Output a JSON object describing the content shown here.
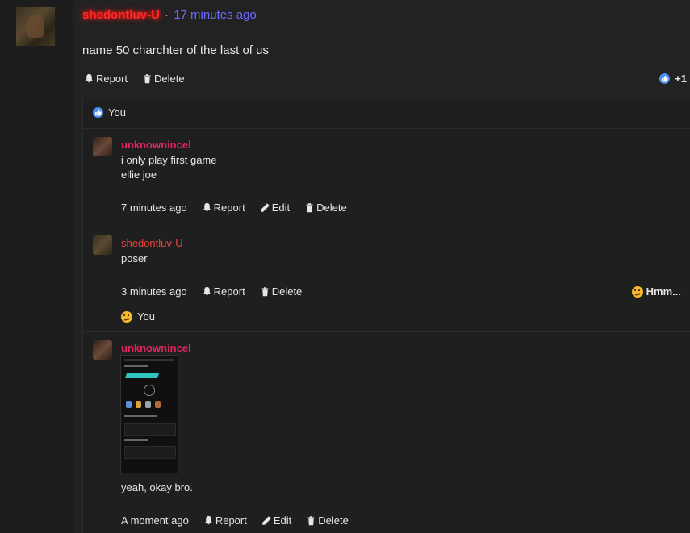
{
  "post": {
    "username": "shedontluv-U",
    "separator": "·",
    "time": "17 minutes ago",
    "text": "name 50 charchter of the last of us",
    "actions": {
      "report": "Report",
      "delete": "Delete"
    },
    "reaction_count": "+1"
  },
  "thread": {
    "reacted_by": "You",
    "replies": [
      {
        "username": "unknownincel",
        "lines": [
          "i only play first game",
          "ellie joe"
        ],
        "time": "7 minutes ago",
        "actions": {
          "report": "Report",
          "edit": "Edit",
          "delete": "Delete"
        }
      },
      {
        "username": "shedontluv-U",
        "lines": [
          "poser"
        ],
        "time": "3 minutes ago",
        "actions": {
          "report": "Report",
          "delete": "Delete"
        },
        "reaction_label": "Hmm...",
        "reacted_by": "You"
      },
      {
        "username": "unknownincel",
        "lines": [
          "yeah, okay bro."
        ],
        "time": "A moment ago",
        "actions": {
          "report": "Report",
          "edit": "Edit",
          "delete": "Delete"
        }
      }
    ]
  },
  "colors": {
    "background": "#222222",
    "username_unknown": "#e0245e",
    "username_shedontluv": "#e8453c",
    "time_link": "#6c6cff",
    "like_blue": "#4a8ff5"
  },
  "icons": [
    "bell-icon",
    "trash-icon",
    "pencil-icon",
    "like-icon",
    "thinking-emoji-icon"
  ]
}
